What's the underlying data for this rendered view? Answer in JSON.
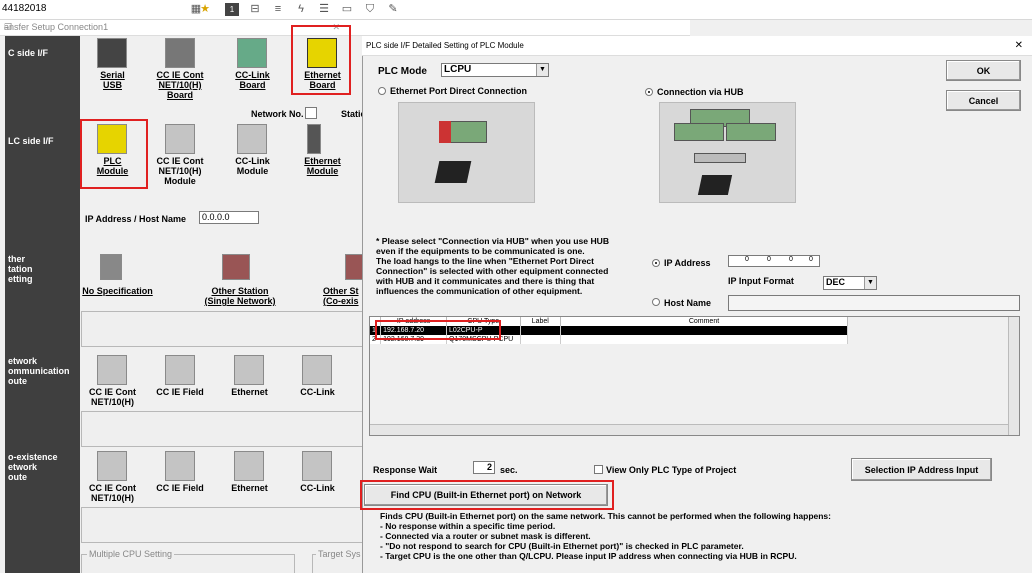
{
  "topbar": {
    "address": "44182018"
  },
  "left": {
    "window_title": "ansfer Setup Connection1",
    "sidebar": [
      "C side I/F",
      "LC side I/F",
      "ther\ntation\netting",
      "etwork\nommunication\noute",
      "o-existence\network\noute"
    ],
    "pc_side": [
      {
        "label": "Serial\nUSB"
      },
      {
        "label": "CC IE Cont\nNET/10(H)\nBoard"
      },
      {
        "label": "CC-Link\nBoard"
      },
      {
        "label": "Ethernet\nBoard"
      }
    ],
    "network_no_label": "Network No.",
    "station_label": "Static",
    "plc_side": [
      {
        "label": "PLC\nModule"
      },
      {
        "label": "CC IE Cont\nNET/10(H)\nModule"
      },
      {
        "label": "CC-Link\nModule"
      },
      {
        "label": "Ethernet\nModule"
      }
    ],
    "ip_label": "IP Address / Host Name",
    "ip_value": "0.0.0.0",
    "other_station": [
      {
        "label": "No Specification"
      },
      {
        "label": "Other Station\n(Single Network)"
      },
      {
        "label": "Other St\n(Co-exis"
      }
    ],
    "net_route": [
      {
        "label": "CC IE Cont\nNET/10(H)"
      },
      {
        "label": "CC IE Field"
      },
      {
        "label": "Ethernet"
      },
      {
        "label": "CC-Link"
      }
    ],
    "coex_route": [
      {
        "label": "CC IE Cont\nNET/10(H)"
      },
      {
        "label": "CC IE Field"
      },
      {
        "label": "Ethernet"
      },
      {
        "label": "CC-Link"
      }
    ],
    "multiple_cpu": "Multiple CPU Setting",
    "target_sys": "Target Sys"
  },
  "dialog": {
    "title": "PLC side I/F Detailed Setting of PLC Module",
    "plc_mode_label": "PLC Mode",
    "plc_mode_value": "LCPU",
    "ok": "OK",
    "cancel": "Cancel",
    "radio_direct": "Ethernet Port Direct Connection",
    "radio_hub": "Connection via HUB",
    "note": "* Please select \"Connection via HUB\" when you use HUB\neven if the equipments to be communicated is one.\nThe load hangs to the line when \"Ethernet Port Direct\nConnection\" is selected with other equipment connected\nwith HUB and it communicates and there is thing that\ninfluences the communication of other equipment.",
    "ip_radio": "IP Address",
    "ip_octets": [
      "0",
      "0",
      "0",
      "0"
    ],
    "ip_input_format": "IP Input Format",
    "format_value": "DEC",
    "host_name": "Host Name",
    "table_headers": [
      "IP address",
      "CPU Type",
      "Label",
      "Comment"
    ],
    "table_rows": [
      [
        "1",
        "192.168.7.20",
        "L02CPU-P",
        "",
        ""
      ],
      [
        "2",
        "192.168.7.39",
        "Q170MSCPU-PCPU",
        "",
        ""
      ]
    ],
    "response_wait": "Response Wait",
    "wait_value": "2",
    "sec": "sec.",
    "view_only": "View Only PLC Type of Project",
    "selection_ip": "Selection IP Address Input",
    "find_cpu": "Find CPU (Built-in Ethernet port) on Network",
    "info": "Finds CPU (Built-in Ethernet port) on the same network. This cannot be performed when the following happens:\n- No response within a specific time period.\n- Connected via a router or subnet mask is different.\n- \"Do not respond to search for CPU (Built-in Ethernet port)\" is checked in PLC parameter.\n- Target CPU is the one other than Q/LCPU. Please input IP address when connecting via HUB in RCPU."
  }
}
